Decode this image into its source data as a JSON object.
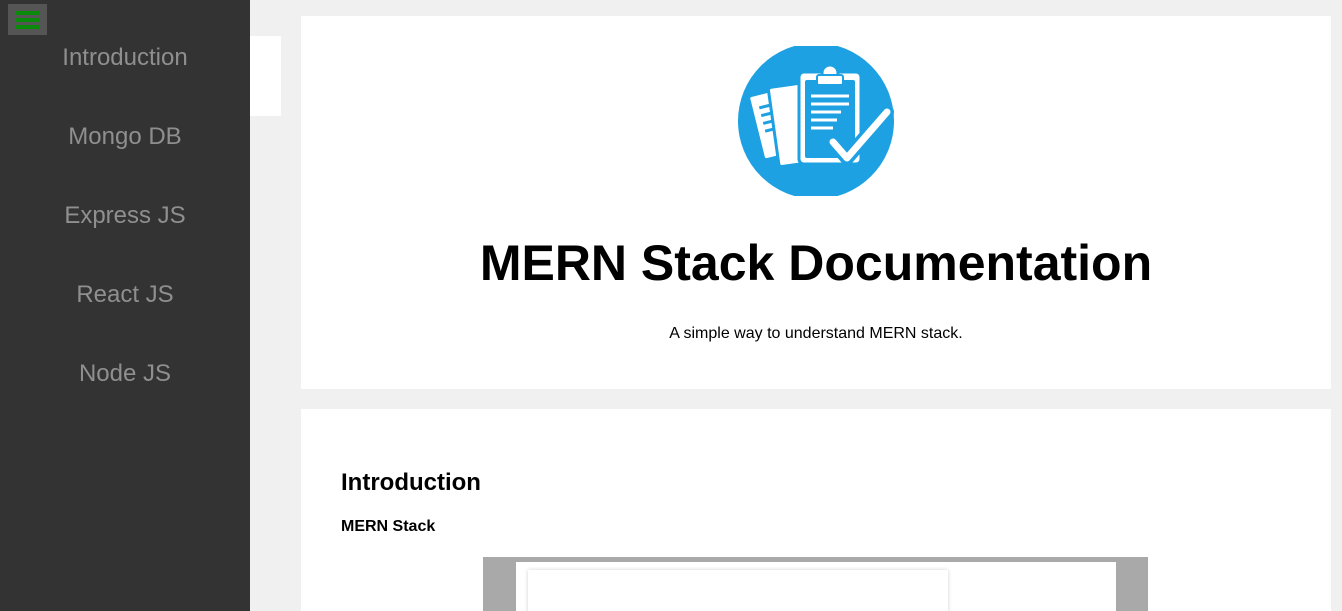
{
  "sidebar": {
    "toggle_icon": "hamburger-menu-icon",
    "items": [
      {
        "label": "Introduction"
      },
      {
        "label": "Mongo DB"
      },
      {
        "label": "Express JS"
      },
      {
        "label": "React JS"
      },
      {
        "label": "Node JS"
      }
    ]
  },
  "hero": {
    "logo_icon": "documentation-clipboard-icon",
    "title": "MERN Stack Documentation",
    "subtitle": "A simple way to understand MERN stack."
  },
  "section": {
    "title": "Introduction",
    "subtitle": "MERN Stack"
  },
  "colors": {
    "sidebar_bg": "#333333",
    "sidebar_text": "#8f8f8f",
    "toggle_accent": "#0a8a0a",
    "logo_blue": "#1da1e2",
    "page_bg": "#f0f0f0"
  }
}
